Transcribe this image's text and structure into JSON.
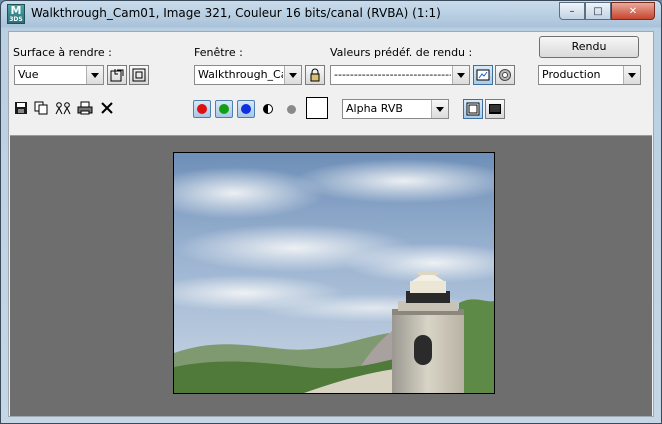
{
  "window": {
    "title": "Walkthrough_Cam01, Image 321, Couleur 16 bits/canal (RVBA) (1:1)",
    "app_icon_text": "3DS",
    "controls": {
      "minimize": "–",
      "maximize": "□",
      "close": "✕"
    }
  },
  "surface": {
    "label": "Surface à rendre :",
    "value": "Vue"
  },
  "fenetre": {
    "label": "Fenêtre :",
    "value": "Walkthrough_Can"
  },
  "presets": {
    "label": "Valeurs prédéf. de rendu :",
    "value": "--------------------------------"
  },
  "render_button": {
    "label": "Rendu"
  },
  "mode": {
    "value": "Production"
  },
  "channel": {
    "value": "Alpha RVB"
  },
  "colors": {
    "red_channel": "#e01010",
    "green_channel": "#12a012",
    "blue_channel": "#1030e0",
    "swatch": "#ffffff"
  },
  "icons": {
    "save": "save-icon",
    "copy": "copy-icon",
    "clone": "clone-icon",
    "print": "print-icon",
    "clear": "clear-icon"
  }
}
